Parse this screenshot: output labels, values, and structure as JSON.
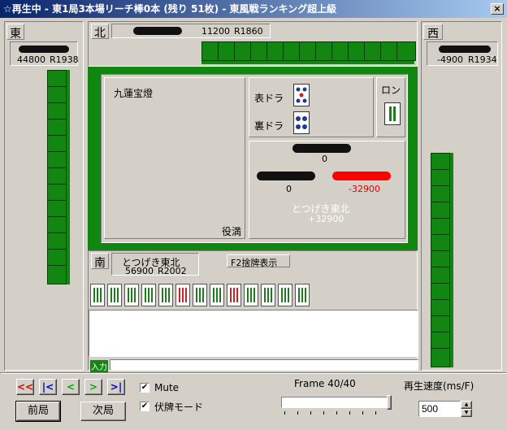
{
  "window": {
    "title": "☆再生中 - 東1局3本場リーチ棒0本 (残り 51枚) - 東風戦ランキング超上級",
    "close": "×"
  },
  "east": {
    "wind": "東",
    "score": "44800",
    "rating": "R1938",
    "tiles": 13
  },
  "north": {
    "wind": "北",
    "score": "11200",
    "rating": "R1860",
    "tiles": 13
  },
  "west": {
    "wind": "西",
    "score": "-4900",
    "rating": "R1934",
    "tiles": 13
  },
  "south": {
    "wind": "南",
    "name": "とつげき東北",
    "score": "56900",
    "rating": "R2002",
    "f2_label": "F2捨牌表示"
  },
  "result": {
    "yaku": "九蓮宝燈",
    "yakuman": "役満",
    "omote_dora": "表ドラ",
    "ura_dora": "裏ドラ",
    "ron_label": "ロン",
    "top_delta": "0",
    "left_delta": "0",
    "right_delta": "-32900",
    "winner_name": "とつげき東北",
    "winner_delta": "+32900"
  },
  "input": {
    "label": "入力",
    "value": ""
  },
  "controls": {
    "nav_first": "<<",
    "nav_prev": "|<",
    "nav_back": "<",
    "nav_fwd": ">",
    "nav_next": ">|",
    "nav_last": ">>",
    "prev_round": "前局",
    "next_round": "次局",
    "mute_label": "Mute",
    "mute_checked": "✔",
    "fuhai_label": "伏牌モード",
    "fuhai_checked": "✔",
    "frame_label": "Frame 40/40",
    "frame_progress": 1.0,
    "speed_label": "再生速度(ms/F)",
    "speed_value": "500",
    "spin_up": "▲",
    "spin_down": "▼"
  }
}
